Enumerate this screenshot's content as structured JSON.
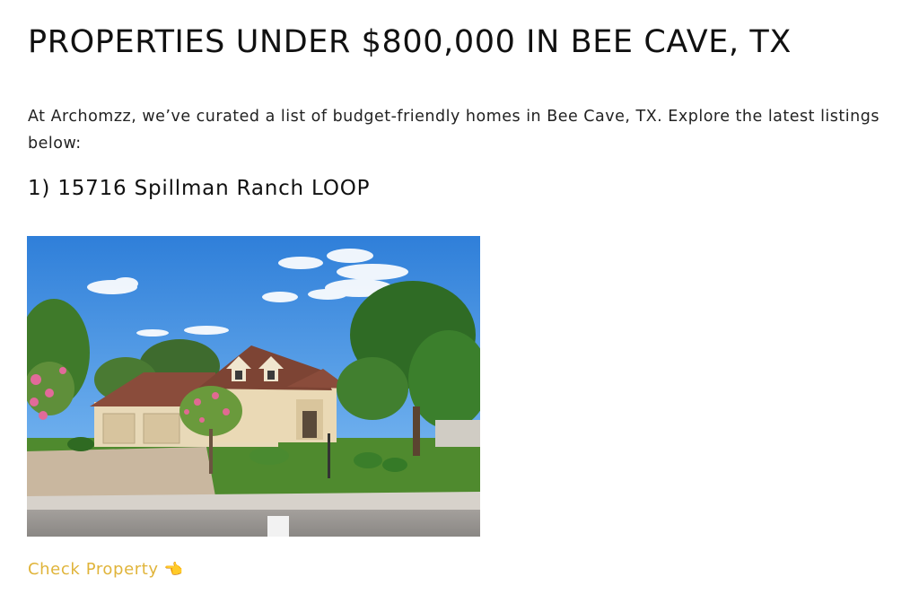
{
  "page": {
    "title": "PROPERTIES UNDER $800,000 IN BEE CAVE, TX",
    "intro": "At Archomzz, we’ve curated a list of budget-friendly homes in Bee Cave, TX. Explore the latest listings below:"
  },
  "listing": {
    "heading": "1) 15716 Spillman Ranch LOOP",
    "photo_icon": "house-photo",
    "link_label": "Check Property",
    "link_icon": "pointing-hand-icon",
    "link_emoji": "👈",
    "link_color": "#e0b43a"
  }
}
